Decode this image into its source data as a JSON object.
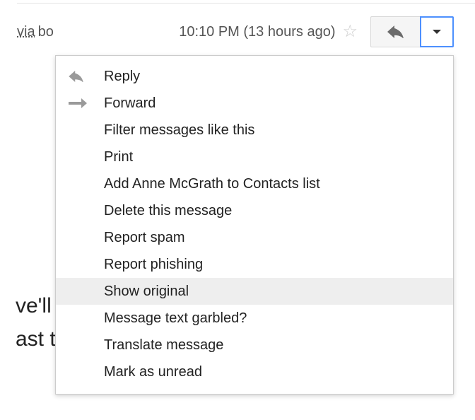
{
  "header": {
    "via_text": "via",
    "via_suffix": "bo",
    "timestamp": "10:10 PM (13 hours ago)"
  },
  "menu": {
    "items": [
      {
        "label": "Reply",
        "icon": "reply"
      },
      {
        "label": "Forward",
        "icon": "forward"
      },
      {
        "label": "Filter messages like this"
      },
      {
        "label": "Print"
      },
      {
        "label": "Add Anne McGrath to Contacts list"
      },
      {
        "label": "Delete this message"
      },
      {
        "label": "Report spam"
      },
      {
        "label": "Report phishing"
      },
      {
        "label": "Show original",
        "hover": true
      },
      {
        "label": "Message text garbled?"
      },
      {
        "label": "Translate message"
      },
      {
        "label": "Mark as unread"
      }
    ]
  },
  "body_fragment": {
    "line1": "ve'll",
    "line2": "ast t"
  }
}
